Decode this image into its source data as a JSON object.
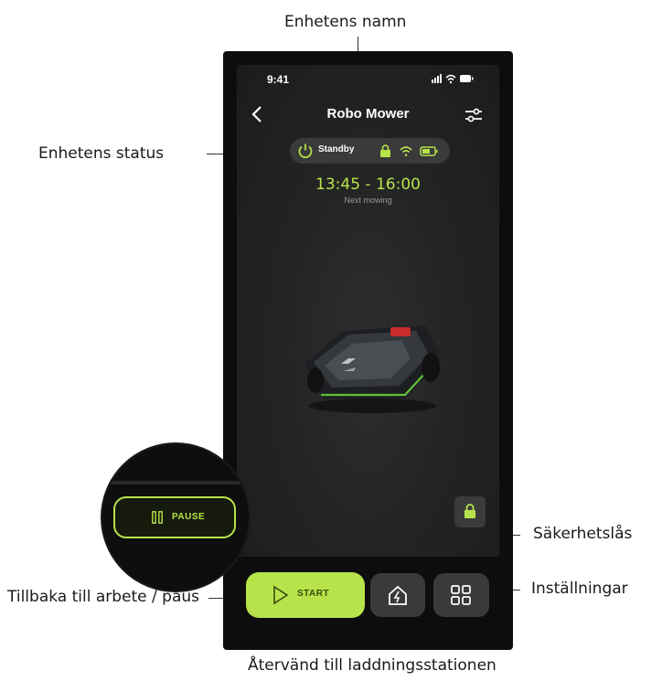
{
  "annotations": {
    "device_name": "Enhetens namn",
    "device_status": "Enhetens status",
    "security_lock": "Säkerhetslås",
    "settings": "Inställningar",
    "back_to_work_pause": "Tillbaka till arbete / paus",
    "return_to_station": "Återvänd till laddningsstationen"
  },
  "status_bar": {
    "time": "9:41"
  },
  "header": {
    "title": "Robo Mower"
  },
  "status": {
    "label": "Standby"
  },
  "schedule": {
    "time_range": "13:45 - 16:00",
    "caption": "Next mowing"
  },
  "buttons": {
    "start_label": "START",
    "pause_label": "PAUSE"
  },
  "colors": {
    "accent": "#b6e34a",
    "background": "#242424",
    "button": "#3a3a3a"
  }
}
